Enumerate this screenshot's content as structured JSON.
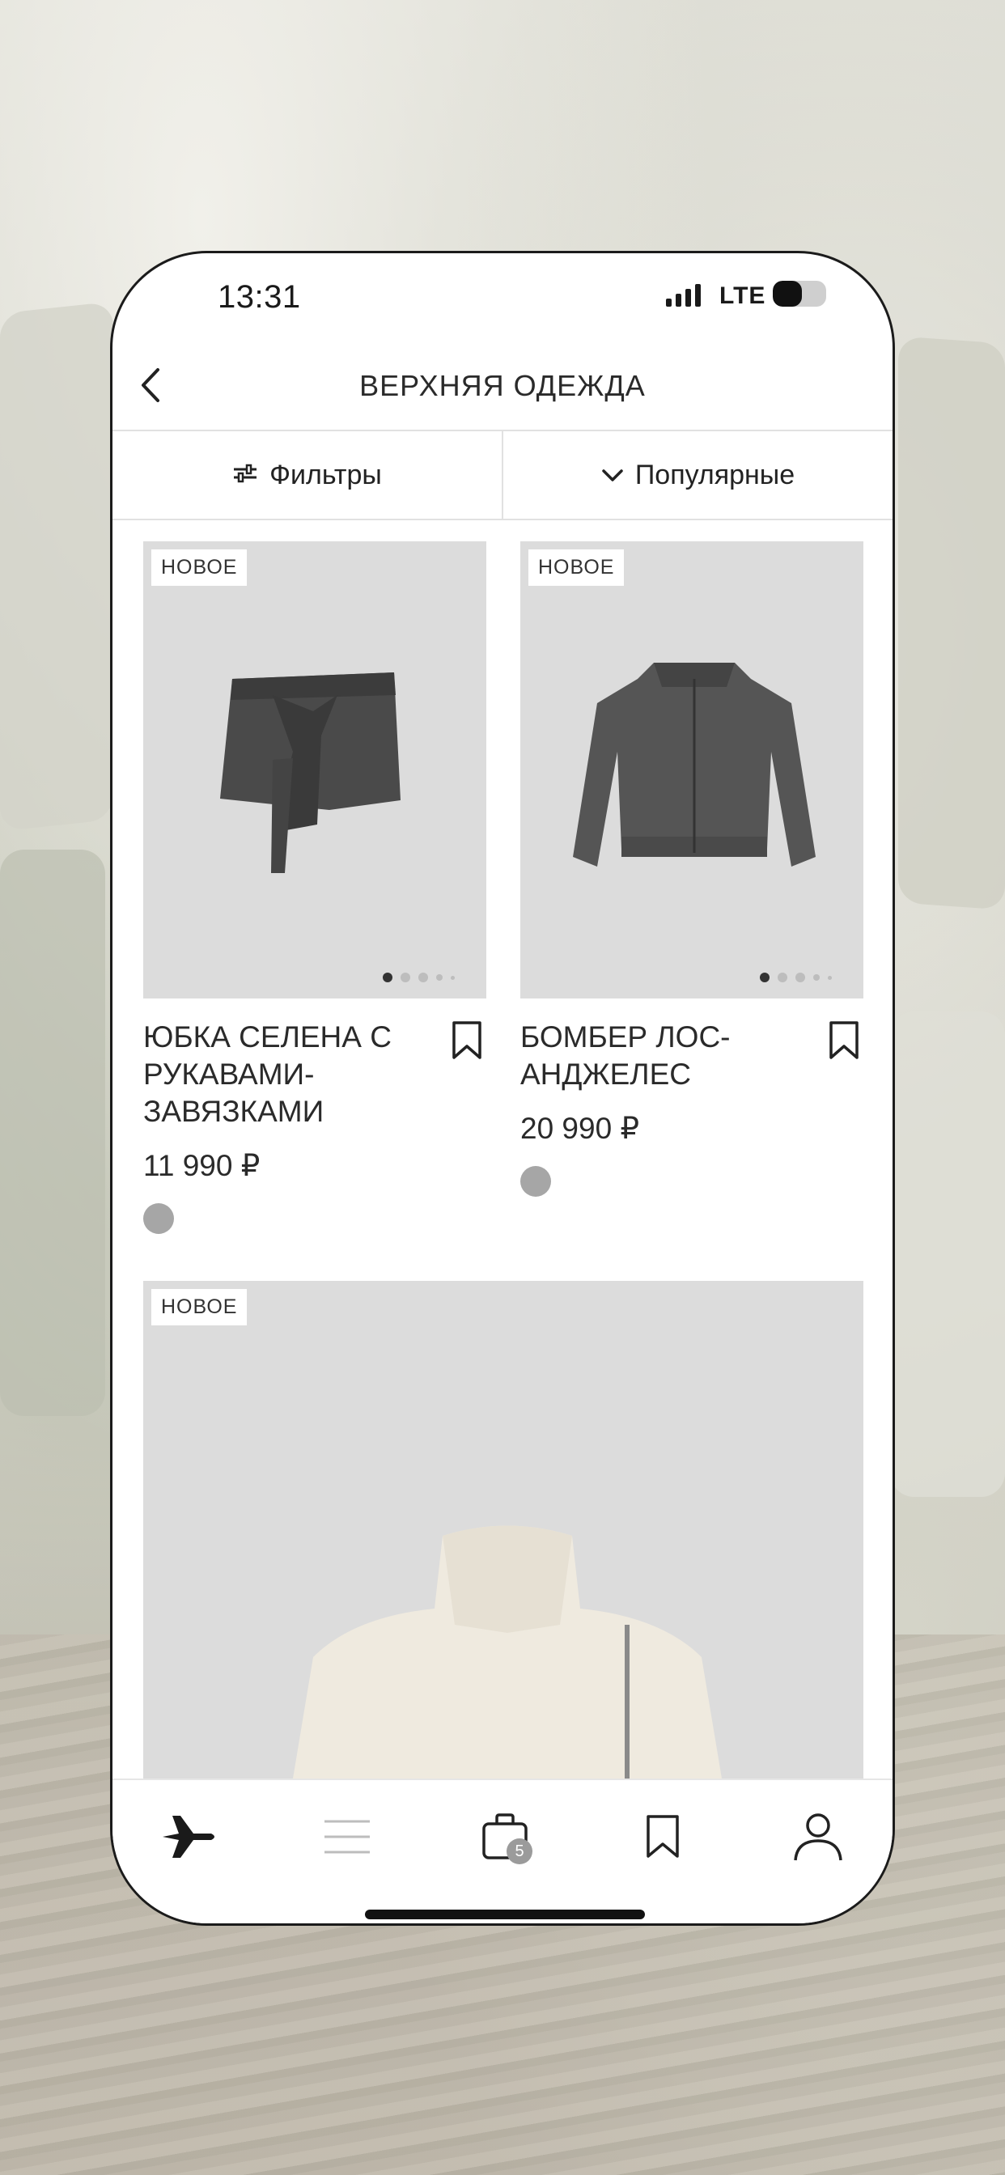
{
  "status": {
    "time": "13:31",
    "network": "LTE",
    "battery_level": 0.55
  },
  "header": {
    "title": "ВЕРХНЯЯ ОДЕЖДА",
    "back_icon": "chevron-left-icon"
  },
  "toolbar": {
    "filters_label": "Фильтры",
    "filters_icon": "sliders-icon",
    "sort_label": "Популярные",
    "sort_icon": "chevron-down-icon"
  },
  "products": [
    {
      "badge": "НОВОЕ",
      "name": "ЮБКА СЕЛЕНА С РУКАВАМИ-ЗАВЯЗКАМИ",
      "price": "11 990 ₽",
      "color": "#a6a6a6"
    },
    {
      "badge": "НОВОЕ",
      "name": "БОМБЕР ЛОС-АНДЖЕЛЕС",
      "price": "20 990 ₽",
      "color": "#a6a6a6"
    },
    {
      "badge": "НОВОЕ"
    }
  ],
  "tabbar": {
    "items": [
      "plane-icon",
      "menu-icon",
      "bag-icon",
      "bookmark-icon",
      "profile-icon"
    ],
    "cart_count": "5"
  }
}
